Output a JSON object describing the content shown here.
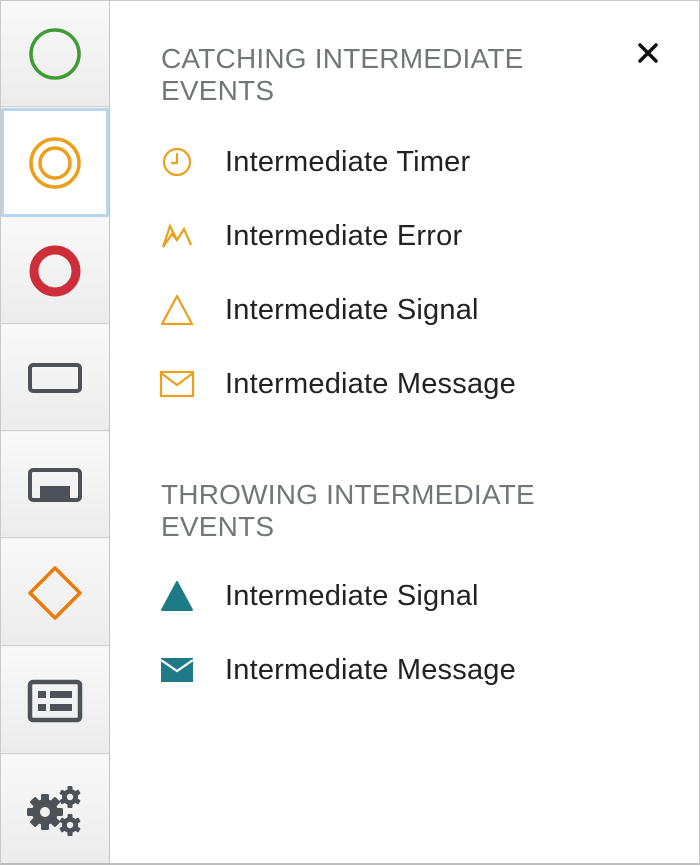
{
  "toolbar": {
    "tools": [
      {
        "icon": "start-event-icon",
        "color": "#3f9c35"
      },
      {
        "icon": "intermediate-event-icon",
        "color": "#ec9f1a",
        "active": true
      },
      {
        "icon": "end-event-icon",
        "color": "#cc2e3a"
      },
      {
        "icon": "task-icon",
        "color": "#4d5258"
      },
      {
        "icon": "subprocess-icon",
        "color": "#4d5258"
      },
      {
        "icon": "gateway-icon",
        "color": "#ec7a08"
      },
      {
        "icon": "lane-icon",
        "color": "#4d5258"
      },
      {
        "icon": "settings-gears-icon",
        "color": "#4d5258"
      }
    ]
  },
  "panel": {
    "close_glyph": "✕",
    "catching": {
      "title": "CATCHING INTERMEDIATE EVENTS",
      "items": [
        {
          "label": "Intermediate Timer",
          "icon": "timer-icon"
        },
        {
          "label": "Intermediate Error",
          "icon": "error-icon"
        },
        {
          "label": "Intermediate Signal",
          "icon": "signal-outline-icon"
        },
        {
          "label": "Intermediate Message",
          "icon": "message-outline-icon"
        }
      ]
    },
    "throwing": {
      "title": "THROWING INTERMEDIATE EVENTS",
      "items": [
        {
          "label": "Intermediate Signal",
          "icon": "signal-filled-icon"
        },
        {
          "label": "Intermediate Message",
          "icon": "message-filled-icon"
        }
      ]
    }
  },
  "colors": {
    "catching_accent": "#ec9f1a",
    "throwing_accent": "#1e7a87",
    "section_title": "#72767b",
    "toolbar_icon": "#4d5258"
  }
}
